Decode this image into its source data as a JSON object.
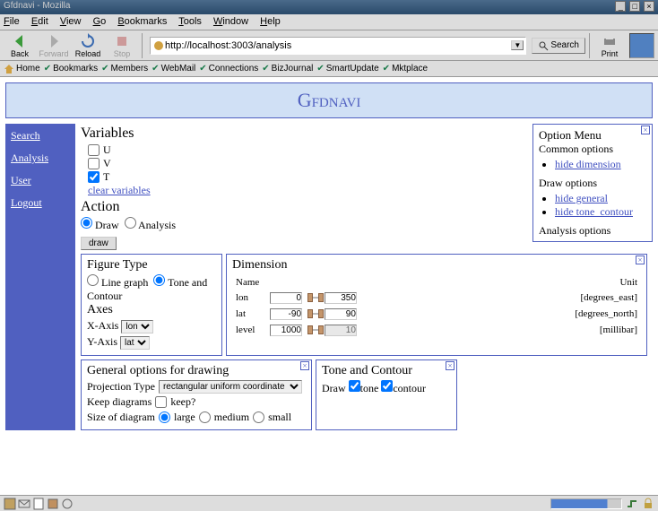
{
  "window": {
    "title": "Gfdnavi - Mozilla"
  },
  "menubar": [
    "File",
    "Edit",
    "View",
    "Go",
    "Bookmarks",
    "Tools",
    "Window",
    "Help"
  ],
  "toolbar": {
    "back": "Back",
    "forward": "Forward",
    "reload": "Reload",
    "stop": "Stop",
    "url": "http://localhost:3003/analysis",
    "search": "Search",
    "print": "Print"
  },
  "linkbar": [
    "Home",
    "Bookmarks",
    "Members",
    "WebMail",
    "Connections",
    "BizJournal",
    "SmartUpdate",
    "Mktplace"
  ],
  "app": {
    "title": "Gfdnavi"
  },
  "sidebar": {
    "items": [
      "Search",
      "Analysis",
      "User",
      "Logout"
    ]
  },
  "vars": {
    "title": "Variables",
    "items": [
      {
        "label": "U",
        "checked": false
      },
      {
        "label": "V",
        "checked": false
      },
      {
        "label": "T",
        "checked": true
      }
    ],
    "clear": "clear variables"
  },
  "action": {
    "title": "Action",
    "options": [
      {
        "label": "Draw",
        "checked": true
      },
      {
        "label": "Analysis",
        "checked": false
      }
    ],
    "button": "draw"
  },
  "figtype": {
    "title": "Figure Type",
    "options": [
      {
        "label": "Line graph",
        "checked": false
      },
      {
        "label": "Tone and Contour",
        "checked": true
      }
    ],
    "axes_title": "Axes",
    "xlabel": "X-Axis",
    "xval": "lon",
    "ylabel": "Y-Axis",
    "yval": "lat"
  },
  "dimension": {
    "title": "Dimension",
    "name_h": "Name",
    "unit_h": "Unit",
    "rows": [
      {
        "name": "lon",
        "lo": "0",
        "hi": "350",
        "unit": "[degrees_east]",
        "h1": 2,
        "h2": 98
      },
      {
        "name": "lat",
        "lo": "-90",
        "hi": "90",
        "unit": "[degrees_north]",
        "h1": 2,
        "h2": 98
      },
      {
        "name": "level",
        "lo": "1000",
        "hi": "10",
        "unit": "[millibar]",
        "h1": 2,
        "h2": 98,
        "ro": true
      }
    ]
  },
  "genopts": {
    "title": "General options for drawing",
    "proj_label": "Projection Type",
    "proj_val": "rectangular uniform coordinate",
    "keep_label": "Keep diagrams",
    "keep_opt": "keep?",
    "keep_checked": false,
    "size_label": "Size of diagram",
    "sizes": [
      {
        "label": "large",
        "checked": true
      },
      {
        "label": "medium",
        "checked": false
      },
      {
        "label": "small",
        "checked": false
      }
    ]
  },
  "tone": {
    "title": "Tone and Contour",
    "draw_label": "Draw",
    "tone": {
      "label": "tone",
      "checked": true
    },
    "contour": {
      "label": "contour",
      "checked": true
    }
  },
  "optmenu": {
    "title": "Option Menu",
    "common_h": "Common options",
    "common": [
      "hide dimension"
    ],
    "draw_h": "Draw options",
    "draw": [
      "hide general",
      "hide tone_contour"
    ],
    "analysis_h": "Analysis options"
  }
}
